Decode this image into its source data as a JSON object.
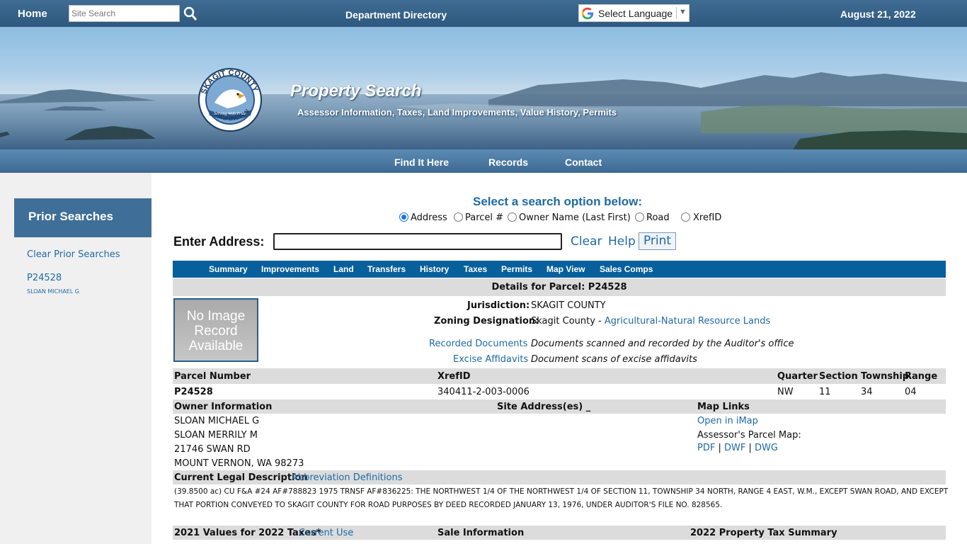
{
  "topbar": {
    "home": "Home",
    "search_placeholder": "Site Search",
    "dept_directory": "Department Directory",
    "language": "Select Language",
    "date": "August 21, 2022"
  },
  "banner": {
    "title": "Property Search",
    "subtitle": "Assessor Information, Taxes, Land Improvements, Value History, Permits",
    "seal": {
      "top": "SKAGIT COUNTY",
      "ribbon": "Serving With Pride",
      "bottom": "WASHINGTON"
    }
  },
  "nav": {
    "items": [
      "Find It Here",
      "Records",
      "Contact"
    ]
  },
  "sidebar": {
    "title": "Prior Searches",
    "clear": "Clear Prior Searches",
    "recent": {
      "parcel": "P24528",
      "owner": "SLOAN MICHAEL G"
    }
  },
  "search": {
    "title": "Select a search option below:",
    "options": [
      "Address",
      "Parcel #",
      "Owner Name (Last First)",
      "Road",
      "XrefID"
    ],
    "selected": "Address",
    "enter_label": "Enter Address:",
    "address_value": "",
    "clear": "Clear",
    "help": "Help",
    "print": "Print"
  },
  "tabs": [
    "Summary",
    "Improvements",
    "Land",
    "Transfers",
    "History",
    "Taxes",
    "Permits",
    "Map View",
    "Sales Comps"
  ],
  "details": {
    "header": "Details for Parcel: P24528",
    "no_image": [
      "No Image",
      "Record",
      "Available"
    ],
    "jurisdiction_label": "Jurisdiction:",
    "jurisdiction": "SKAGIT COUNTY",
    "zoning_label": "Zoning Designation:",
    "zoning_prefix": "Skagit County - ",
    "zoning_link": "Agricultural-Natural Resource Lands",
    "recorded_docs": "Recorded Documents",
    "recorded_docs_desc": "Documents scanned and recorded by the Auditor's office",
    "excise": "Excise Affidavits",
    "excise_desc": "Document scans of excise affidavits"
  },
  "parcel_table": {
    "headers": {
      "parcel": "Parcel Number",
      "xref": "XrefID",
      "quarter": "Quarter",
      "section": "Section",
      "township": "Township",
      "range": "Range"
    },
    "values": {
      "parcel": "P24528",
      "xref": "340411-2-003-0006",
      "quarter": "NW",
      "section": "11",
      "township": "34",
      "range": "04"
    }
  },
  "owner": {
    "header": "Owner Information",
    "lines": [
      "SLOAN MICHAEL G",
      "SLOAN MERRILY M",
      "21746 SWAN RD",
      "MOUNT VERNON, WA  98273"
    ],
    "site_header": "Site Address(es) _"
  },
  "map_links": {
    "header": "Map Links",
    "imap": "Open in iMap",
    "parcel_map": "Assessor's Parcel Map:",
    "pdf": "PDF",
    "dwf": "DWF",
    "dwg": "DWG",
    "sep": "|"
  },
  "legal": {
    "header": "Current Legal Description",
    "abbrev": "Abbreviation Definitions",
    "line1": "(39.8500 ac) CU F&A #24 AF#788823 1975 TRNSF AF#836225: THE NORTHWEST 1/4 OF THE NORTHWEST 1/4 OF SECTION 11, TOWNSHIP 34 NORTH, RANGE 4 EAST, W.M., EXCEPT SWAN ROAD, AND EXCEPT",
    "line2": "THAT PORTION CONVEYED TO SKAGIT COUNTY FOR ROAD PURPOSES BY DEED RECORDED JANUARY 13, 1976, UNDER AUDITOR'S FILE NO. 828565."
  },
  "values_row": {
    "values_header": "2021 Values for 2022 Taxes*",
    "current_use": "Current Use",
    "sale_header": "Sale Information",
    "tax_header": "2022 Property Tax Summary"
  }
}
